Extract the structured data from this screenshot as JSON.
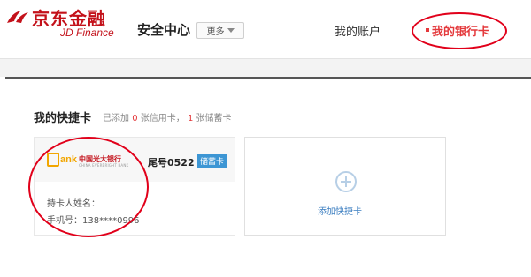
{
  "header": {
    "logo_cn": "京东金融",
    "logo_en": "JD Finance",
    "section_name": "安全中心",
    "more_label": "更多",
    "nav_account": "我的账户",
    "nav_bank_card": "我的银行卡"
  },
  "quick_cards": {
    "title": "我的快捷卡",
    "summary_prefix": "已添加",
    "credit_count": "0",
    "credit_label": "张信用卡，",
    "debit_count": "1",
    "debit_label": "张储蓄卡"
  },
  "card": {
    "bank_logo_mark": "ank",
    "bank_name": "中国光大银行",
    "bank_name_en": "CHINA EVERBRIGHT BANK",
    "tail_label": "尾号0522",
    "card_type": "储蓄卡",
    "holder_label": "持卡人姓名：",
    "phone_label": "手机号：138****0996"
  },
  "add_card": {
    "label": "添加快捷卡"
  },
  "colors": {
    "brand_red": "#c3111a",
    "accent_red": "#e4393c",
    "tag_blue": "#3d96d4",
    "link_blue": "#3d7fc1"
  },
  "icons": {
    "more": "chevron-down-icon",
    "add": "plus-circle-icon",
    "logo": "jd-finance-logo-icon"
  }
}
